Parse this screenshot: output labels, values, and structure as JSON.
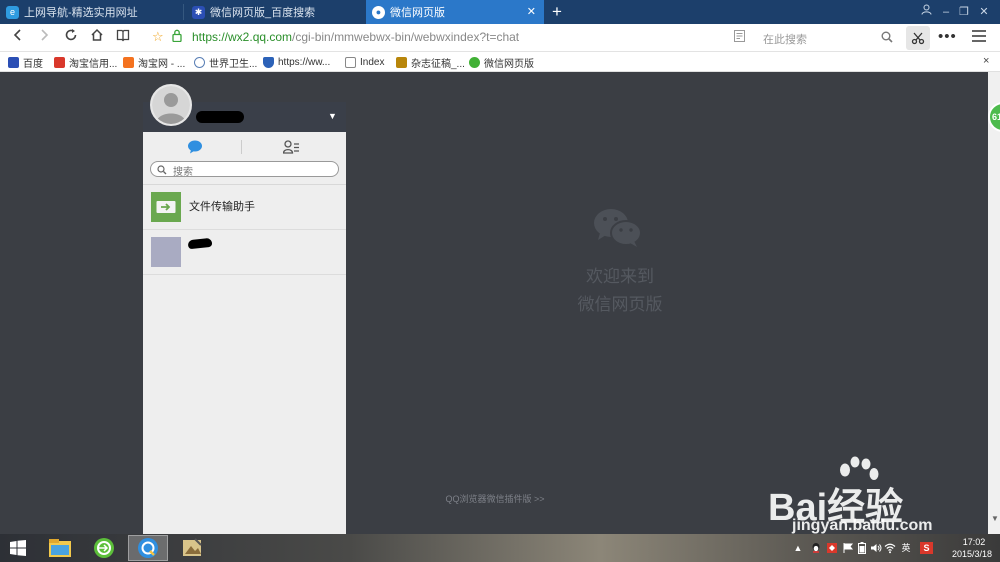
{
  "browser": {
    "tabs": [
      {
        "label": "上网导航-精选实用网址",
        "icon": "qq-browser-icon"
      },
      {
        "label": "微信网页版_百度搜索",
        "icon": "baidu-paw-icon"
      },
      {
        "label": "微信网页版",
        "icon": "wechat-icon"
      }
    ],
    "new_tab": "+",
    "url": {
      "highlight": "https://wx2.qq.com",
      "rest": "/cgi-bin/mmwebwx-bin/webwxindex?t=chat"
    },
    "search_placeholder": "在此搜索",
    "bookmarks": [
      {
        "label": "百度"
      },
      {
        "label": "淘宝信用..."
      },
      {
        "label": "淘宝网 - ..."
      },
      {
        "label": "世界卫生..."
      },
      {
        "label": "https://ww..."
      },
      {
        "label": "Index"
      },
      {
        "label": "杂志征稿_..."
      },
      {
        "label": "微信网页版"
      }
    ],
    "close_x": "×",
    "side_badge": "61"
  },
  "wechat": {
    "search_placeholder": "搜索",
    "chats": [
      {
        "name": "文件传输助手",
        "avatar_color": "#6aa84f"
      },
      {
        "name": "",
        "avatar_color": "#a9abc2"
      }
    ],
    "welcome_line1": "欢迎来到",
    "welcome_line2": "微信网页版",
    "plugin_link": "QQ浏览器微信插件版 >>"
  },
  "watermark": {
    "logo": "Bai经验",
    "url": "jingyan.baidu.com"
  },
  "taskbar": {
    "time": "17:02",
    "date": "2015/3/18",
    "ime": "英",
    "ime_s": "S"
  }
}
